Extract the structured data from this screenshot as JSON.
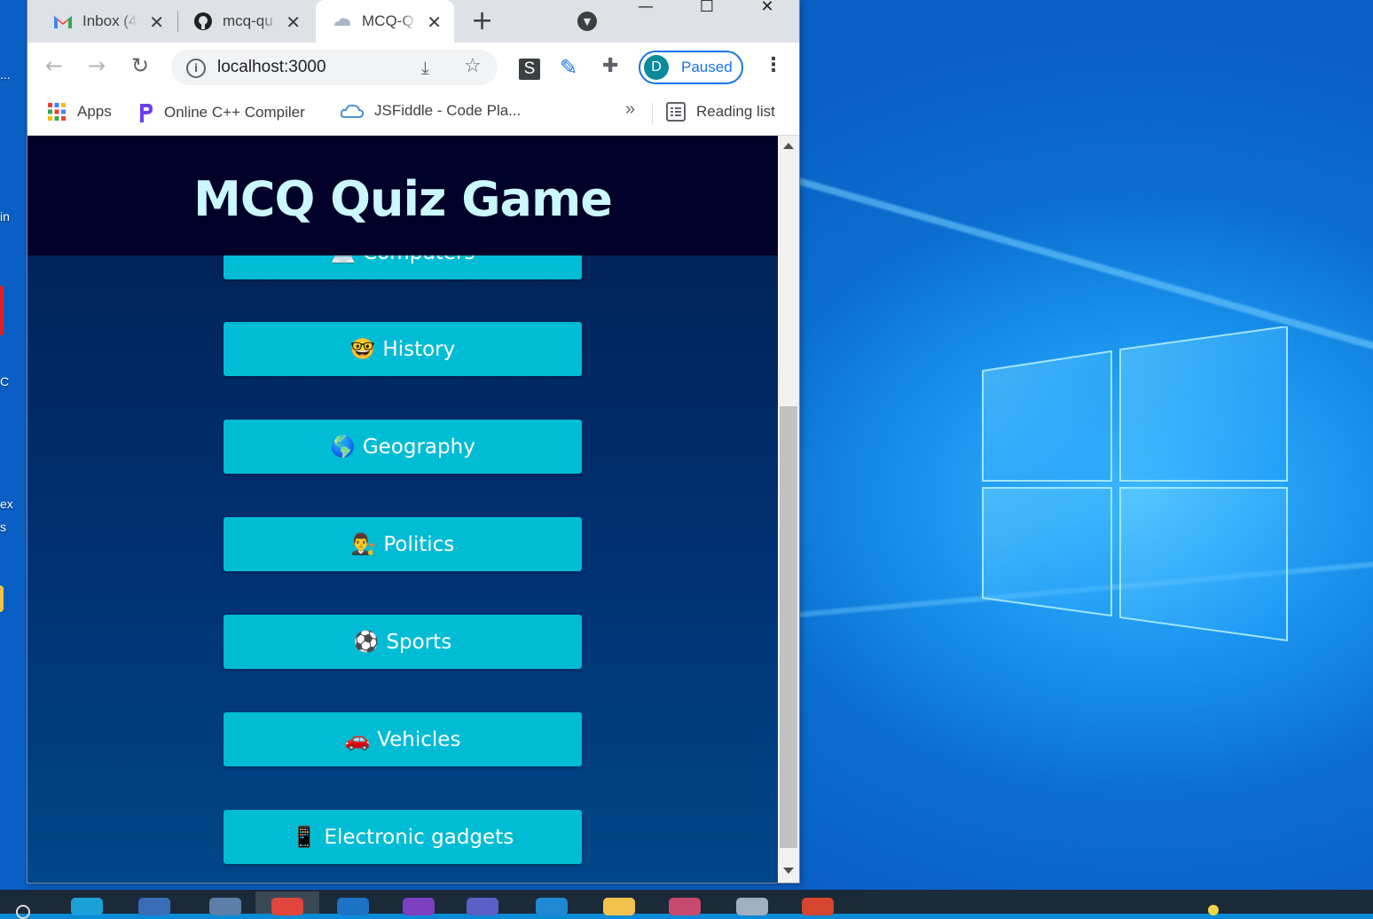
{
  "desktop": {
    "left_edge_labels": [
      "...",
      "in",
      "C",
      "ex",
      "s"
    ]
  },
  "browser": {
    "tabs": [
      {
        "title": "Inbox (4",
        "icon": "gmail-icon",
        "active": false
      },
      {
        "title": "mcq-qu",
        "icon": "github-icon",
        "active": false
      },
      {
        "title": "MCQ-Q",
        "icon": "cloud-icon",
        "active": true
      }
    ],
    "address": "localhost:3000",
    "profile": {
      "initial": "D",
      "status": "Paused"
    },
    "extensions": {
      "s_label": "S"
    },
    "bookmarks": [
      {
        "label": "Apps"
      },
      {
        "label": "Online C++ Compiler"
      },
      {
        "label": "JSFiddle - Code Pla..."
      }
    ],
    "reading_list": "Reading list"
  },
  "page": {
    "title": "MCQ Quiz Game",
    "categories": [
      {
        "label": "Computers",
        "emoji": "💻"
      },
      {
        "label": "History",
        "emoji": "🤓"
      },
      {
        "label": "Geography",
        "emoji": "🌎"
      },
      {
        "label": "Politics",
        "emoji": "👨‍⚖️"
      },
      {
        "label": "Sports",
        "emoji": "⚽"
      },
      {
        "label": "Vehicles",
        "emoji": "🚗"
      },
      {
        "label": "Electronic gadgets",
        "emoji": "📱"
      }
    ]
  },
  "colors": {
    "header_bg": "#000028",
    "title": "#cbf7ff",
    "button_bg": "#00bcd4",
    "page_bg_top": "#001f4e",
    "page_bg_bottom": "#004789"
  }
}
